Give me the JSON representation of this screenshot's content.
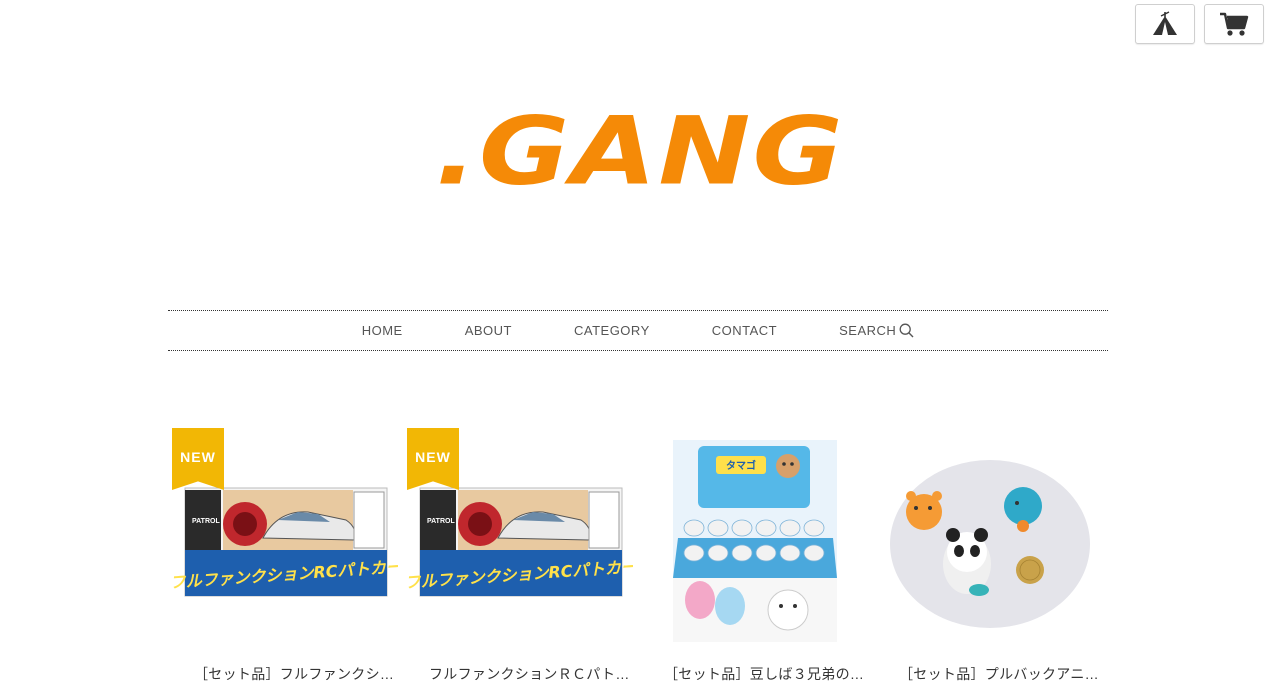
{
  "colors": {
    "brand": "#f58a07",
    "badge": "#f2b705",
    "nav_text": "#555555"
  },
  "header": {
    "logo_text": ".GANG",
    "icons": [
      "tent-icon",
      "cart-icon"
    ]
  },
  "nav": {
    "items": [
      {
        "label": "HOME"
      },
      {
        "label": "ABOUT"
      },
      {
        "label": "CATEGORY"
      },
      {
        "label": "CONTACT"
      },
      {
        "label": "SEARCH",
        "icon": "search-icon"
      }
    ]
  },
  "products": [
    {
      "name": "［セット品］フルファンクシ…",
      "badge": "NEW",
      "box_text": "フルファンクションRCパトカー",
      "box_side": "PATROL"
    },
    {
      "name": "フルファンクションＲＣパト…",
      "badge": "NEW",
      "box_text": "フルファンクションRCパトカー",
      "box_side": "PATROL"
    },
    {
      "name": "［セット品］豆しば３兄弟の…",
      "badge": null,
      "box_text": "タマゴ"
    },
    {
      "name": "［セット品］プルバックアニ…",
      "badge": null
    }
  ]
}
